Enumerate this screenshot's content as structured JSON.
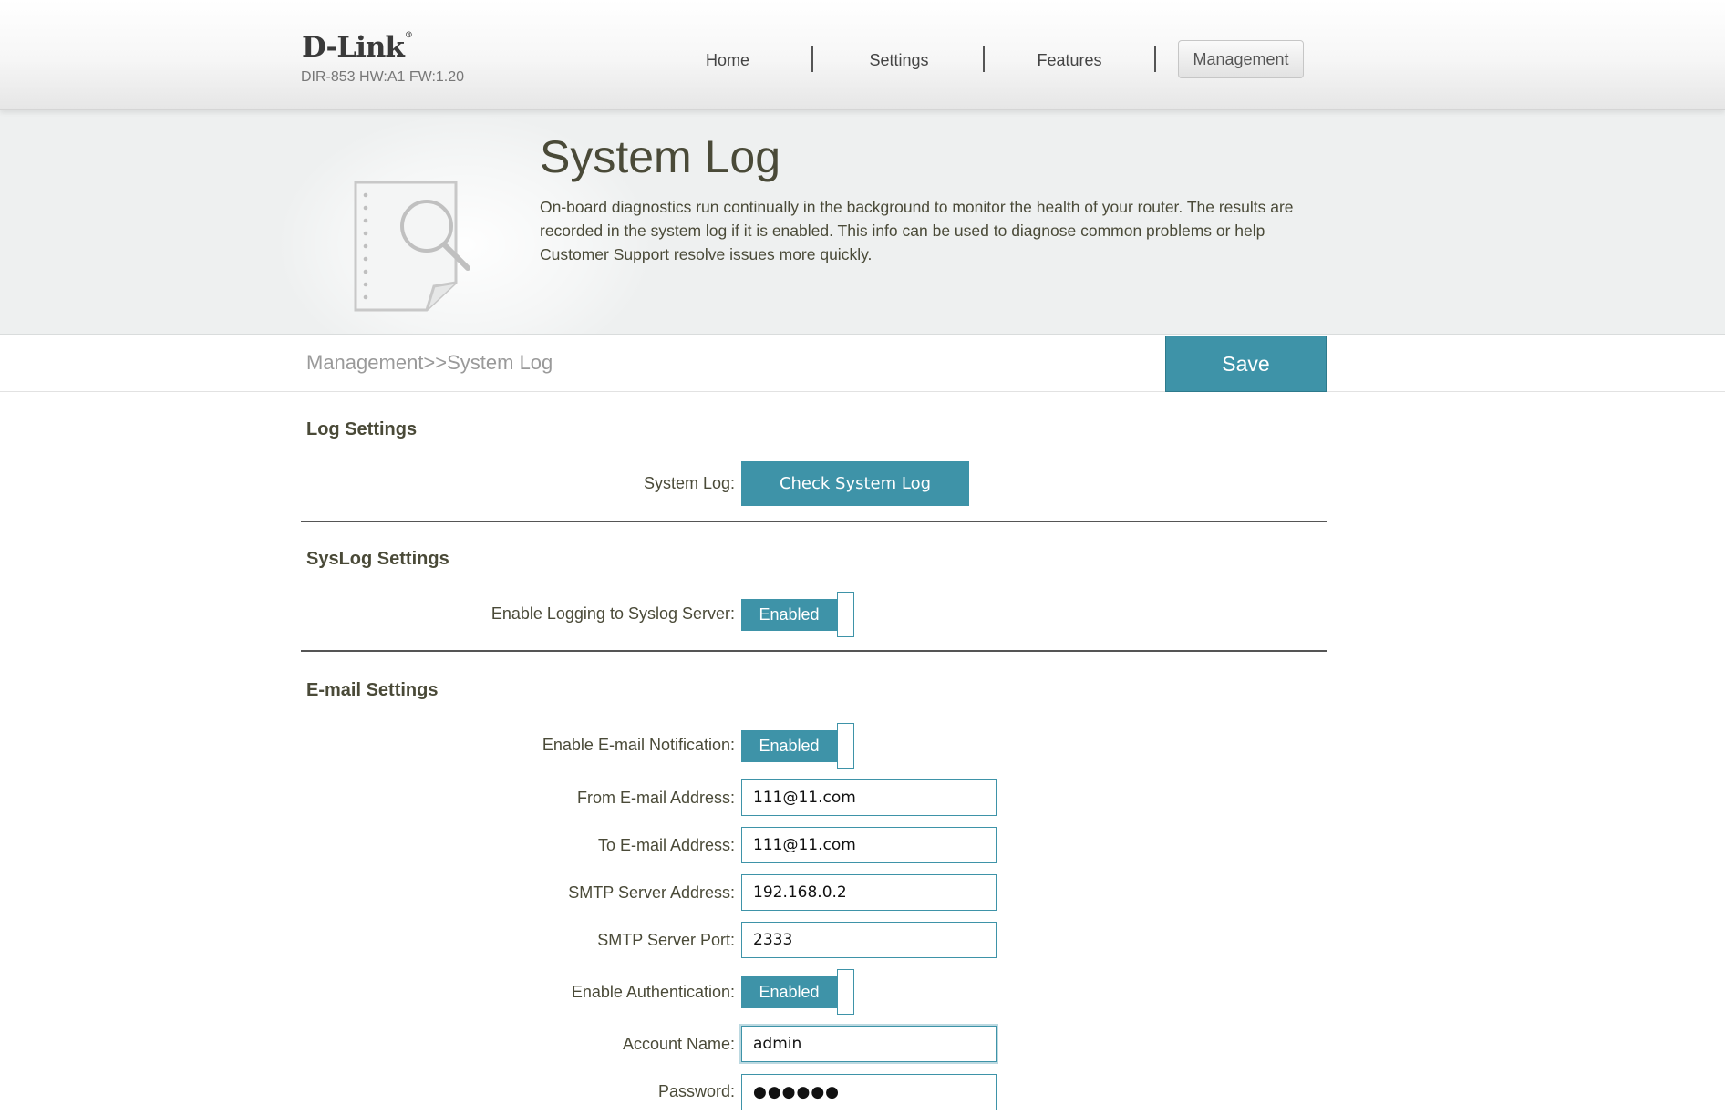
{
  "header": {
    "brand": "D-Link",
    "brand_mark": "®",
    "model": "DIR-853 HW:A1 FW:1.20",
    "nav": [
      {
        "label": "Home"
      },
      {
        "label": "Settings"
      },
      {
        "label": "Features"
      },
      {
        "label": "Management"
      }
    ],
    "active_nav": "Management"
  },
  "banner": {
    "title": "System Log",
    "description": "On-board diagnostics run continually in the background to monitor the health of your router. The results are recorded in the system log if it is enabled. This info can be used to diagnose common problems or help Customer Support resolve issues more quickly.",
    "icon": "document-search-icon"
  },
  "breadcrumb": "Management>>System Log",
  "save_label": "Save",
  "log_settings": {
    "title": "Log Settings",
    "system_log_label": "System Log:",
    "check_button": "Check System Log"
  },
  "syslog_settings": {
    "title": "SysLog Settings",
    "enable_label": "Enable Logging to Syslog Server:",
    "enable_state": "Enabled"
  },
  "email_settings": {
    "title": "E-mail Settings",
    "notification_label": "Enable E-mail Notification:",
    "notification_state": "Enabled",
    "from_label": "From E-mail Address:",
    "from_value": "111@11.com",
    "to_label": "To E-mail Address:",
    "to_value": "111@11.com",
    "smtp_address_label": "SMTP Server Address:",
    "smtp_address_value": "192.168.0.2",
    "smtp_port_label": "SMTP Server Port:",
    "smtp_port_value": "2333",
    "auth_label": "Enable Authentication:",
    "auth_state": "Enabled",
    "account_label": "Account Name:",
    "account_value": "admin",
    "password_label": "Password:",
    "password_value": "●●●●●●"
  },
  "colors": {
    "accent": "#3e93a8",
    "text": "#4a4a38",
    "breadcrumb": "#9a9a9a"
  }
}
